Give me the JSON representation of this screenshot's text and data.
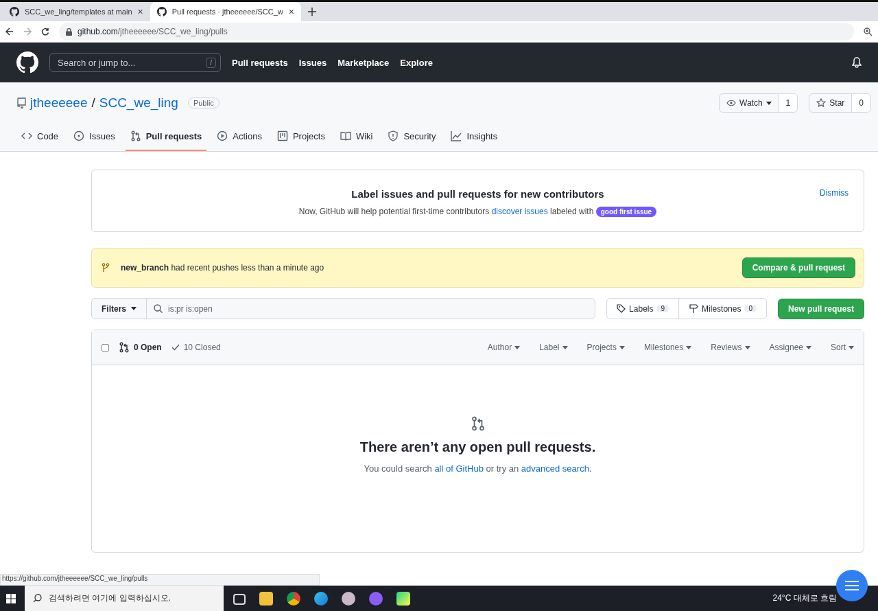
{
  "browser": {
    "tabs": [
      {
        "title": "SCC_we_ling/templates at main",
        "selected": false
      },
      {
        "title": "Pull requests · jtheeeeee/SCC_w",
        "selected": true
      }
    ],
    "tab_close": "×",
    "url_host": "github.com",
    "url_path": "/jtheeeeee/SCC_we_ling/pulls"
  },
  "header": {
    "search_placeholder": "Search or jump to...",
    "slash_key": "/",
    "nav": [
      "Pull requests",
      "Issues",
      "Marketplace",
      "Explore"
    ]
  },
  "repo": {
    "owner": "jtheeeeee",
    "separator": "/",
    "name": "SCC_we_ling",
    "visibility": "Public",
    "watch": {
      "label": "Watch",
      "count": "1"
    },
    "star": {
      "label": "Star",
      "count": "0"
    }
  },
  "repo_tabs": [
    {
      "label": "Code",
      "selected": false
    },
    {
      "label": "Issues",
      "selected": false
    },
    {
      "label": "Pull requests",
      "selected": true
    },
    {
      "label": "Actions",
      "selected": false
    },
    {
      "label": "Projects",
      "selected": false
    },
    {
      "label": "Wiki",
      "selected": false
    },
    {
      "label": "Security",
      "selected": false
    },
    {
      "label": "Insights",
      "selected": false
    }
  ],
  "contributors_banner": {
    "title": "Label issues and pull requests for new contributors",
    "text_before": "Now, GitHub will help potential first-time contributors",
    "link": "discover issues",
    "text_after": "labeled with",
    "label": "good first issue",
    "dismiss": "Dismiss"
  },
  "push_banner": {
    "branch": "new_branch",
    "text": "had recent pushes less than a minute ago",
    "button": "Compare & pull request"
  },
  "toolbar": {
    "filters": "Filters",
    "search_value": "is:pr is:open",
    "labels": {
      "label": "Labels",
      "count": "9"
    },
    "milestones": {
      "label": "Milestones",
      "count": "0"
    },
    "new_button": "New pull request"
  },
  "list": {
    "select_all_checked": false,
    "open": "0 Open",
    "closed": "10 Closed",
    "open_selected": true,
    "filters": [
      "Author",
      "Label",
      "Projects",
      "Milestones",
      "Reviews",
      "Assignee",
      "Sort"
    ],
    "empty_title": "There aren’t any open pull requests.",
    "empty_before": "You could search",
    "empty_link1": "all of GitHub",
    "empty_mid": "or try an",
    "empty_link2": "advanced search",
    "empty_end": "."
  },
  "status_url": "https://github.com/jtheeeeee/SCC_we_ling/pulls",
  "taskbar": {
    "search_placeholder": "검색하려면 여기에 입력하십시오.",
    "weather": "24°C 대체로 흐림"
  }
}
